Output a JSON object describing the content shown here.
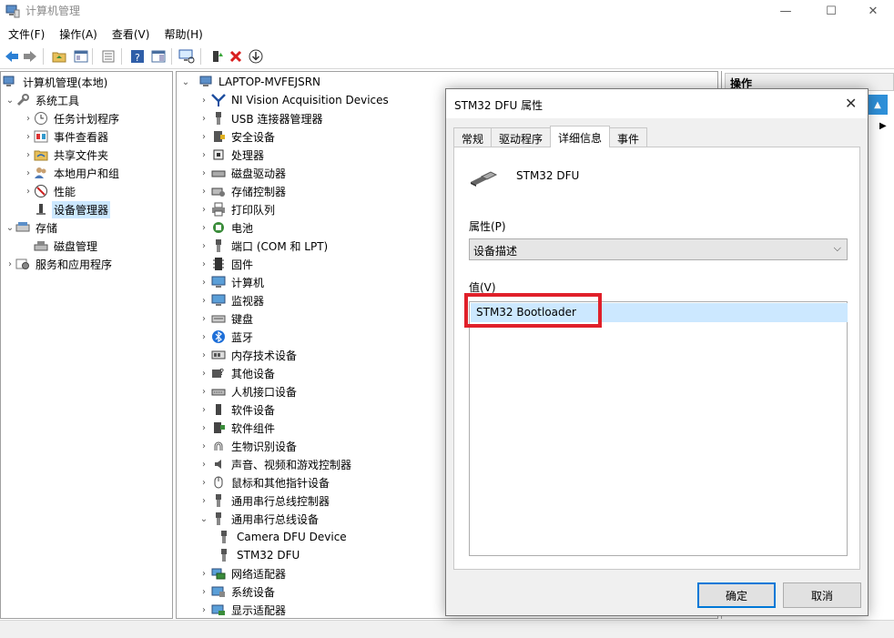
{
  "window": {
    "title": "计算机管理",
    "minimize_glyph": "—",
    "maximize_glyph": "☐",
    "close_glyph": "✕"
  },
  "menu": [
    "文件(F)",
    "操作(A)",
    "查看(V)",
    "帮助(H)"
  ],
  "left_tree": {
    "root": "计算机管理(本地)",
    "system_tools": "系统工具",
    "task_scheduler": "任务计划程序",
    "event_viewer": "事件查看器",
    "shared_folders": "共享文件夹",
    "local_users": "本地用户和组",
    "performance": "性能",
    "device_manager": "设备管理器",
    "storage": "存储",
    "disk_management": "磁盘管理",
    "services": "服务和应用程序"
  },
  "device_tree": {
    "computer": "LAPTOP-MVFEJSRN",
    "items": [
      {
        "label": "NI Vision Acquisition Devices",
        "icon": "ni-vision-icon"
      },
      {
        "label": "USB 连接器管理器",
        "icon": "usb-icon"
      },
      {
        "label": "安全设备",
        "icon": "security-device-icon"
      },
      {
        "label": "处理器",
        "icon": "processor-icon"
      },
      {
        "label": "磁盘驱动器",
        "icon": "disk-drive-icon"
      },
      {
        "label": "存储控制器",
        "icon": "storage-controller-icon"
      },
      {
        "label": "打印队列",
        "icon": "printer-icon"
      },
      {
        "label": "电池",
        "icon": "battery-icon"
      },
      {
        "label": "端口 (COM 和 LPT)",
        "icon": "port-icon"
      },
      {
        "label": "固件",
        "icon": "firmware-icon"
      },
      {
        "label": "计算机",
        "icon": "computer-icon"
      },
      {
        "label": "监视器",
        "icon": "monitor-icon"
      },
      {
        "label": "键盘",
        "icon": "keyboard-icon"
      },
      {
        "label": "蓝牙",
        "icon": "bluetooth-icon"
      },
      {
        "label": "内存技术设备",
        "icon": "memory-icon"
      },
      {
        "label": "其他设备",
        "icon": "unknown-device-icon"
      },
      {
        "label": "人机接口设备",
        "icon": "hid-icon"
      },
      {
        "label": "软件设备",
        "icon": "software-device-icon"
      },
      {
        "label": "软件组件",
        "icon": "software-component-icon"
      },
      {
        "label": "生物识别设备",
        "icon": "fingerprint-icon"
      },
      {
        "label": "声音、视频和游戏控制器",
        "icon": "speaker-icon"
      },
      {
        "label": "鼠标和其他指针设备",
        "icon": "mouse-icon"
      },
      {
        "label": "通用串行总线控制器",
        "icon": "usb-icon"
      },
      {
        "label": "通用串行总线设备",
        "icon": "usb-icon"
      },
      {
        "label": "Camera DFU Device",
        "icon": "usb-icon"
      },
      {
        "label": "STM32 DFU",
        "icon": "usb-icon"
      },
      {
        "label": "网络适配器",
        "icon": "network-icon"
      },
      {
        "label": "系统设备",
        "icon": "system-device-icon"
      },
      {
        "label": "显示适配器",
        "icon": "display-adapter-icon"
      }
    ]
  },
  "actions_pane": {
    "header": "操作"
  },
  "dialog": {
    "title": "STM32 DFU 属性",
    "tabs": [
      "常规",
      "驱动程序",
      "详细信息",
      "事件"
    ],
    "device_name": "STM32 DFU",
    "property_label": "属性(P)",
    "property_value": "设备描述",
    "value_label": "值(V)",
    "value_item": "STM32 Bootloader",
    "ok_label": "确定",
    "cancel_label": "取消"
  },
  "colors": {
    "selection": "#cce8ff",
    "highlight_box": "#e0202a",
    "accent": "#0078d7"
  }
}
